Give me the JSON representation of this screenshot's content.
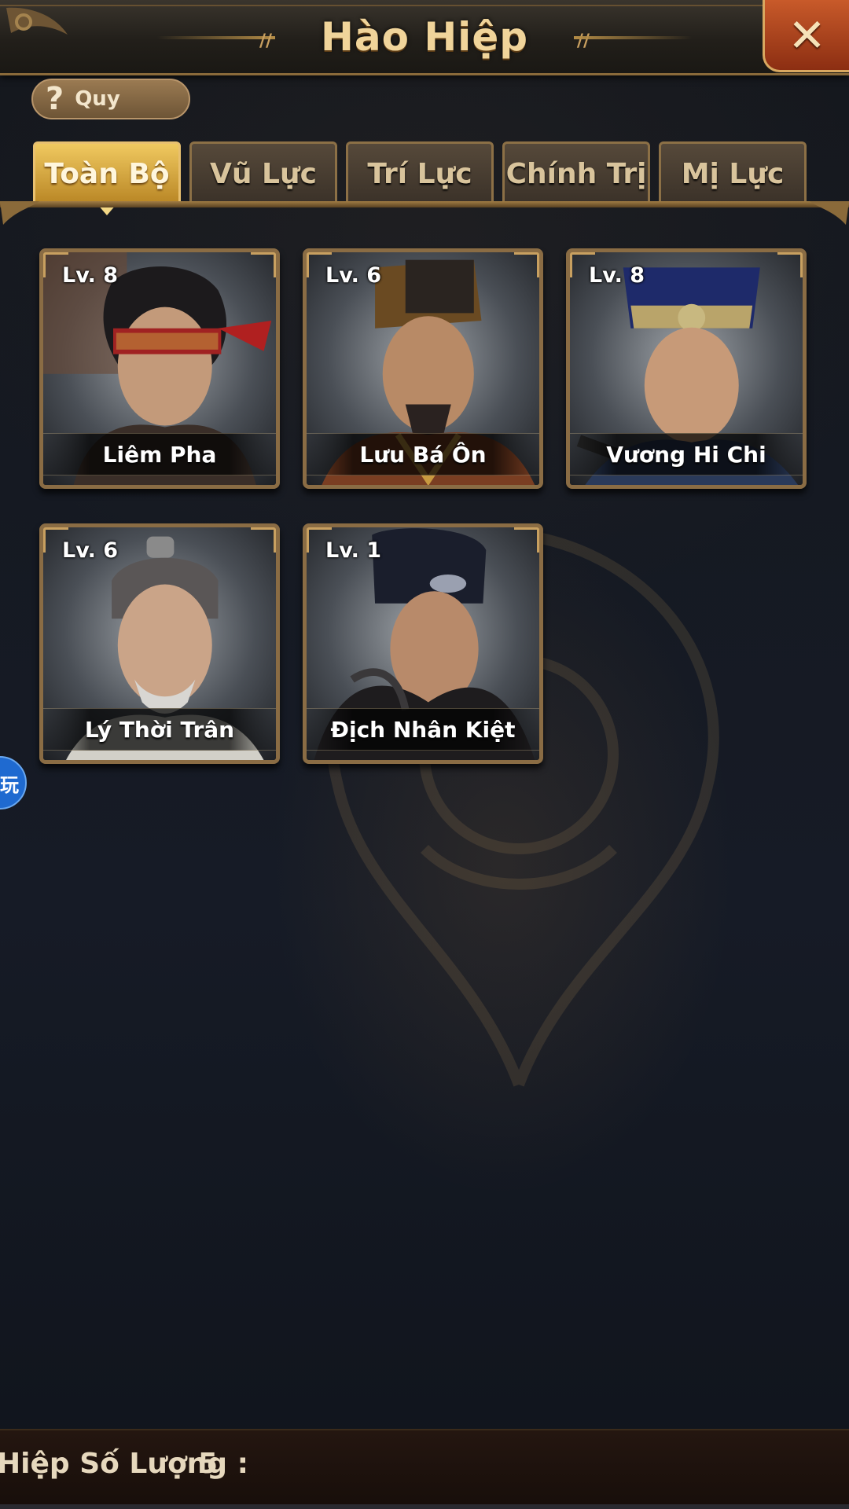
{
  "header": {
    "title": "Hào Hiệp",
    "close_label": "✕"
  },
  "rule_button": {
    "label": "Quy",
    "icon": "question-icon"
  },
  "tabs": [
    {
      "label": "Toàn Bộ",
      "active": true
    },
    {
      "label": "Vũ Lực",
      "active": false
    },
    {
      "label": "Trí Lực",
      "active": false
    },
    {
      "label": "Chính Trị",
      "active": false
    },
    {
      "label": "Mị Lực",
      "active": false
    }
  ],
  "heroes": [
    {
      "level": "Lv.  8",
      "name": "Liêm Pha"
    },
    {
      "level": "Lv.  6",
      "name": "Lưu Bá Ôn"
    },
    {
      "level": "Lv.  8",
      "name": "Vương Hi Chi"
    },
    {
      "level": "Lv.  6",
      "name": "Lý Thời Trân"
    },
    {
      "level": "Lv.  1",
      "name": "Địch Nhân Kiệt"
    }
  ],
  "side_widget": {
    "label": "玩"
  },
  "footer": {
    "count_label": "Hiệp Số Lượng :",
    "count_value": "5"
  },
  "colors": {
    "tab_active": "#f0c960",
    "tab_inactive": "#4a3e32",
    "card_frame": "#8a6c44",
    "close_button": "#c85a2a"
  }
}
